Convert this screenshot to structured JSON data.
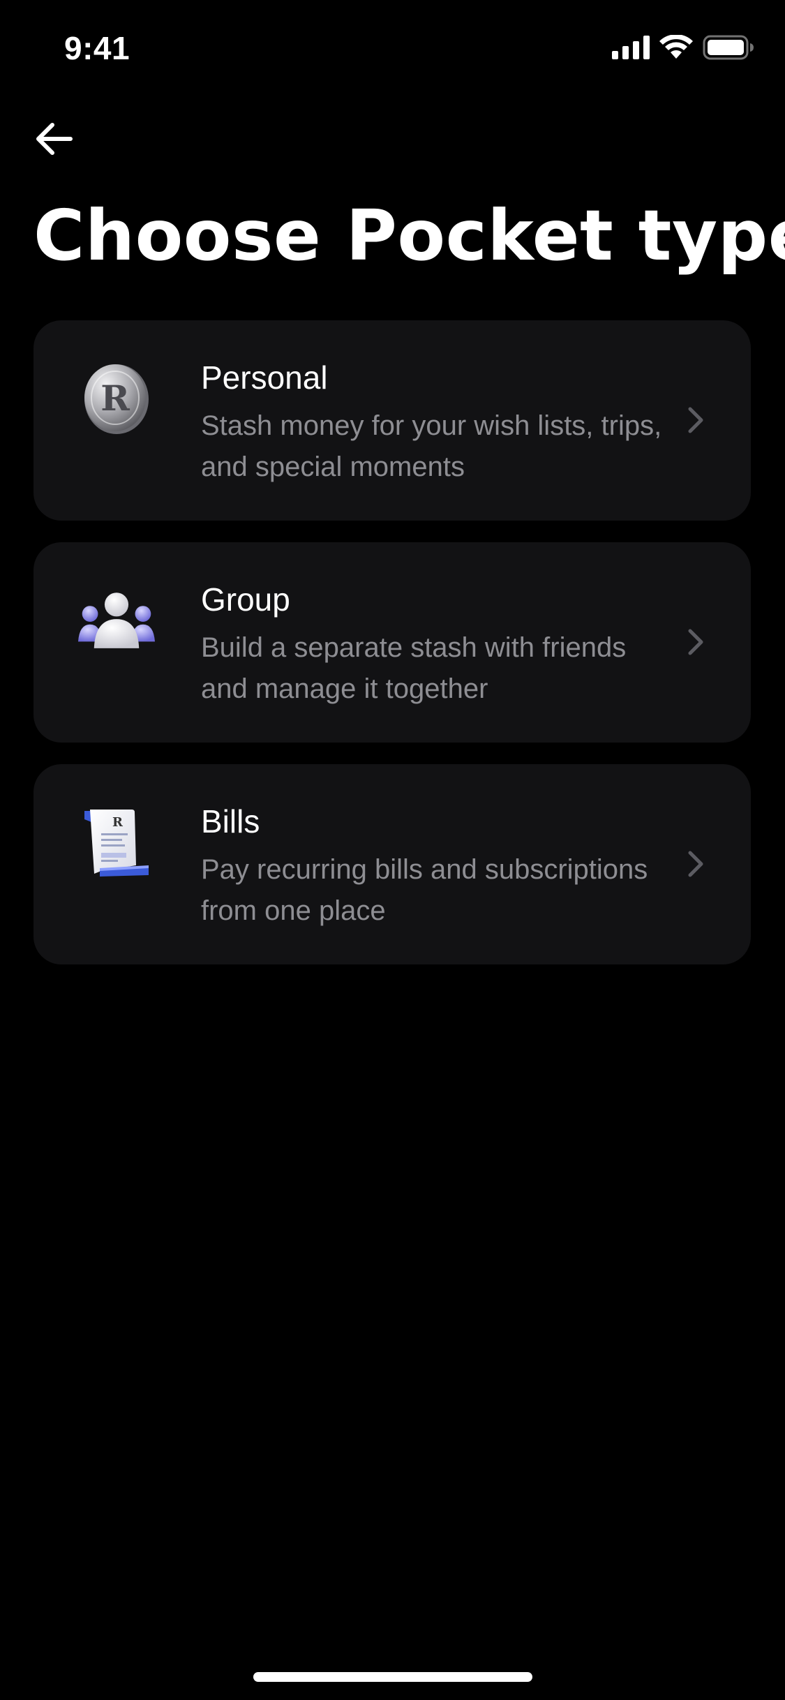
{
  "status_bar": {
    "time": "9:41",
    "signal_icon": "cellular-signal-icon",
    "wifi_icon": "wifi-icon",
    "battery_icon": "battery-icon"
  },
  "header": {
    "back_icon": "arrow-left-icon",
    "title": "Choose Pocket type"
  },
  "options": [
    {
      "icon": "coin-icon",
      "title": "Personal",
      "description": "Stash money for your wish lists, trips, and special moments"
    },
    {
      "icon": "group-people-icon",
      "title": "Group",
      "description": "Build a separate stash with friends and manage it together"
    },
    {
      "icon": "bill-receipt-icon",
      "title": "Bills",
      "description": "Pay recurring bills and subscriptions from one place"
    }
  ],
  "colors": {
    "background": "#000000",
    "card": "#121214",
    "text_primary": "#ffffff",
    "text_secondary": "#8e8e93",
    "accent_purple": "#6f6bd8",
    "accent_blue": "#3b5bd9"
  }
}
